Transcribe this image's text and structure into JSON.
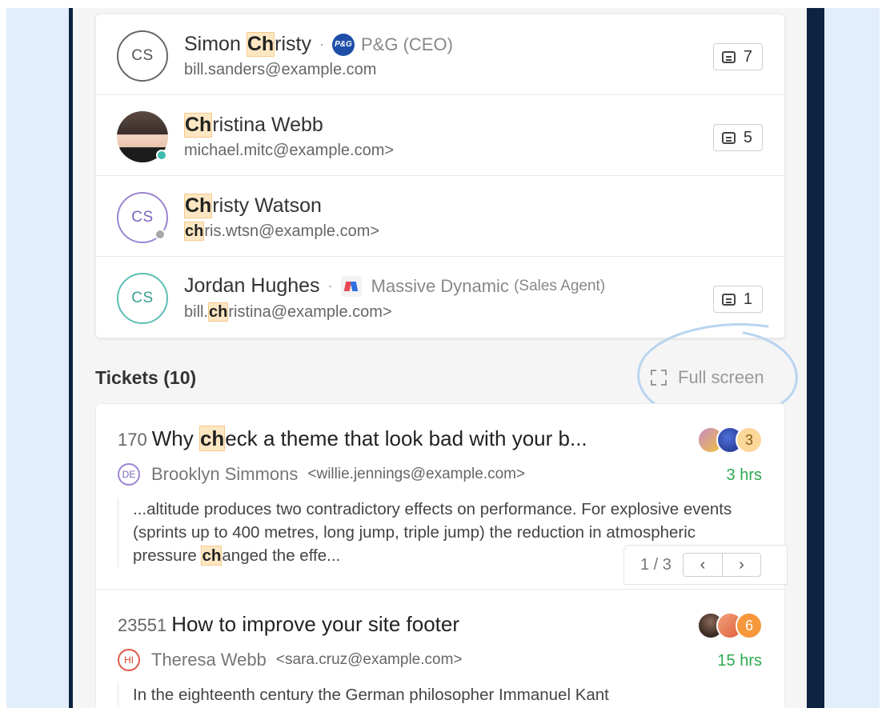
{
  "contacts": [
    {
      "initials": "CS",
      "name_pre": "Simon ",
      "name_hl": "Ch",
      "name_post": "risty",
      "org_logo_text": "P&G",
      "org_name": "P&G",
      "org_role": "(CEO)",
      "email_pre": "bill.sanders@example.com",
      "email_hl": "",
      "email_post": "",
      "ticket_count": "7"
    },
    {
      "initials": "",
      "name_pre": "",
      "name_hl": "Ch",
      "name_post": "ristina Webb",
      "email_pre": "michael.mitc@example.com>",
      "email_hl": "",
      "email_post": "",
      "ticket_count": "5"
    },
    {
      "initials": "CS",
      "name_pre": "",
      "name_hl": "Ch",
      "name_post": "risty Watson",
      "email_pre": "",
      "email_hl": "ch",
      "email_post": "ris.wtsn@example.com>"
    },
    {
      "initials": "CS",
      "name_pre": "Jordan Hughes",
      "name_hl": "",
      "name_post": "",
      "org_name": "Massive Dynamic",
      "org_role": "(Sales Agent)",
      "email_pre": "bill.",
      "email_hl": "ch",
      "email_post": "ristina@example.com>",
      "ticket_count": "1"
    }
  ],
  "tickets_section": {
    "title": "Tickets (10)",
    "fullscreen_label": "Full screen"
  },
  "tickets": [
    {
      "number": "170",
      "title_pre": "Why ",
      "title_hl": "ch",
      "title_post": "eck a theme that look bad with your b...",
      "requester_initials": "DE",
      "requester_name": "Brooklyn Simmons",
      "requester_email": "<willie.jennings@example.com>",
      "time": "3 hrs",
      "assignee_count": "3",
      "body_pre": "...altitude produces two contradictory effects on performance. For explosive events (sprints up to 400 metres, long jump, triple jump) the reduction in atmospheric pressure ",
      "body_hl": "ch",
      "body_post": "anged the effe...",
      "pager_text": "1 / 3",
      "pager_prev": "‹",
      "pager_next": "›"
    },
    {
      "number": "23551",
      "title_pre": "How to improve your site footer",
      "title_hl": "",
      "title_post": "",
      "requester_initials": "HI",
      "requester_name": "Theresa Webb",
      "requester_email": "<sara.cruz@example.com>",
      "time": "15 hrs",
      "assignee_count": "6",
      "body_pre": "In the eighteenth century the German philosopher Immanuel Kant"
    }
  ],
  "colors": {
    "accent_green": "#2fa84f",
    "highlight": "#fde7c2",
    "sidebar_dark": "#0d2440",
    "background_blue": "#e3eefc"
  }
}
